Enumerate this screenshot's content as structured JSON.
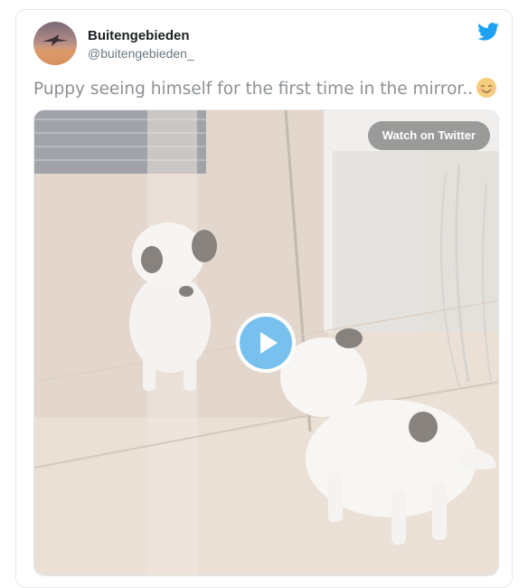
{
  "tweet": {
    "display_name": "Buitengebieden",
    "handle": "@buitengebieden_",
    "text": "Puppy seeing himself for the first time in the mirror..",
    "emoji": "smiling-face-icon"
  },
  "media": {
    "watch_label": "Watch on Twitter",
    "play_icon": "play-icon"
  },
  "brand": {
    "logo_icon": "twitter-bird-icon",
    "accent": "#1da1f2",
    "play_color": "#78c1ee"
  }
}
